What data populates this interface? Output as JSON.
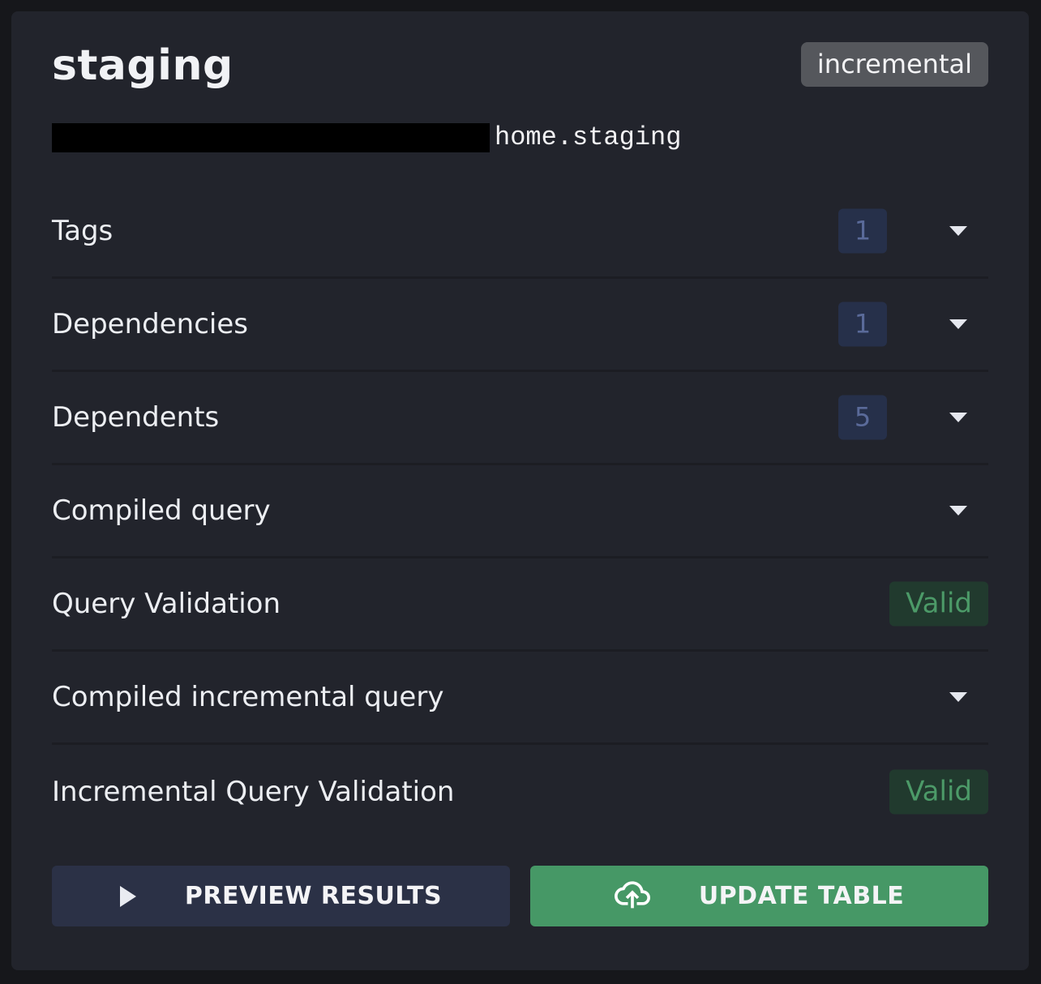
{
  "header": {
    "title": "staging",
    "type_badge": "incremental",
    "path": "home.staging"
  },
  "rows": [
    {
      "label": "Tags",
      "count": "1"
    },
    {
      "label": "Dependencies",
      "count": "1"
    },
    {
      "label": "Dependents",
      "count": "5"
    },
    {
      "label": "Compiled query"
    },
    {
      "label": "Query Validation",
      "status": "Valid"
    },
    {
      "label": "Compiled incremental query"
    },
    {
      "label": "Incremental Query Validation",
      "status": "Valid"
    }
  ],
  "buttons": {
    "preview": {
      "label": "PREVIEW RESULTS",
      "icon": "play-icon"
    },
    "update": {
      "label": "UPDATE TABLE",
      "icon": "cloud-upload-icon"
    }
  },
  "colors": {
    "panel": "#22242c",
    "count_badge": "#26304a",
    "valid_badge": "#213a2e",
    "valid_text": "#4c9a68",
    "preview_button": "#2b3146",
    "update_button": "#469866"
  }
}
